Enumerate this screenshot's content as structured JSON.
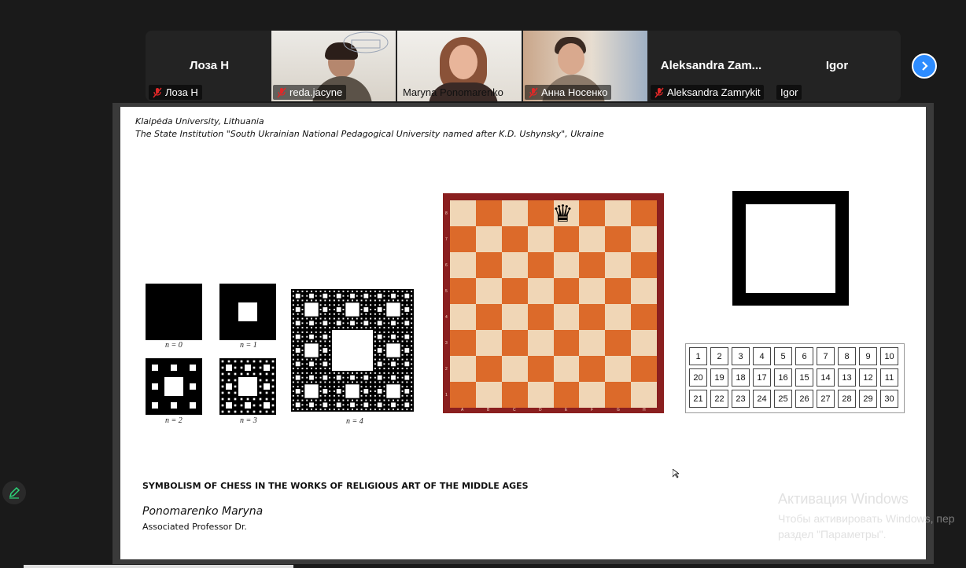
{
  "participants": [
    {
      "name": "Лоза Н",
      "tag": "Лоза Н",
      "muted": true,
      "video": false
    },
    {
      "name": "reda.jacyne",
      "tag": "reda.jacyne",
      "muted": true,
      "video": true
    },
    {
      "name": "Maryna Ponomarenko",
      "tag": "Maryna Ponomarenko",
      "muted": false,
      "video": true,
      "active": true
    },
    {
      "name": "Анна Носенко",
      "tag": "Анна Носенко",
      "muted": true,
      "video": true
    },
    {
      "name": "Aleksandra  Zam...",
      "tag": "Aleksandra Zamrykit",
      "muted": true,
      "video": false
    },
    {
      "name": "Igor",
      "tag": "Igor",
      "muted": false,
      "video": false
    }
  ],
  "slide": {
    "affiliation_1": "Klaipėda University, Lithuania",
    "affiliation_2": "The State Institution \"South Ukrainian National Pedagogical University named after K.D. Ushynsky\", Ukraine",
    "title": "SYMBOLISM OF CHESS IN THE WORKS OF RELIGIOUS ART OF THE MIDDLE AGES",
    "author": "Ponomarenko Maryna",
    "position": "Associated Professor Dr.",
    "fractal_labels": [
      "n = 0",
      "n = 1",
      "n = 2",
      "n = 3",
      "n = 4"
    ],
    "board_files": [
      "A",
      "B",
      "C",
      "D",
      "E",
      "F",
      "G",
      "H"
    ],
    "board_ranks": [
      "8",
      "7",
      "6",
      "5",
      "4",
      "3",
      "2",
      "1"
    ],
    "queen_icon": "♛",
    "number_rows": [
      [
        "1",
        "2",
        "3",
        "4",
        "5",
        "6",
        "7",
        "8",
        "9",
        "10"
      ],
      [
        "20",
        "19",
        "18",
        "17",
        "16",
        "15",
        "14",
        "13",
        "12",
        "11"
      ],
      [
        "21",
        "22",
        "23",
        "24",
        "25",
        "26",
        "27",
        "28",
        "29",
        "30"
      ]
    ]
  },
  "windows_activation": {
    "title": "Активация Windows",
    "line1": "Чтобы активировать Windows, пер",
    "line2": "раздел \"Параметры\"."
  },
  "icons": {
    "next": "chevron-right-icon",
    "annotate": "pencil-icon",
    "mic_off": "mic-off-icon"
  },
  "colors": {
    "active_speaker": "#2dd67a",
    "next_button": "#2d8cff",
    "mic_off": "#e02828"
  }
}
